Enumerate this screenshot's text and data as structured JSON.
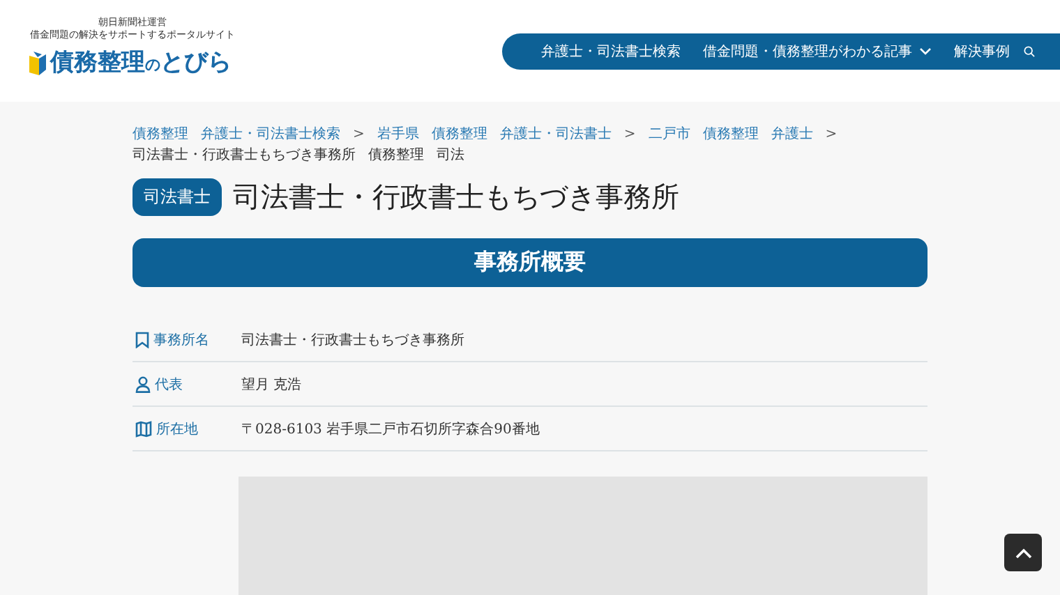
{
  "header": {
    "tagline_1": "朝日新聞社運営",
    "tagline_2": "借金問題の解決をサポートするポータルサイト",
    "logo": [
      {
        "text": "債務整理",
        "kind": "large"
      },
      {
        "text": "の",
        "kind": "small"
      },
      {
        "text": "とびら",
        "kind": "large"
      }
    ]
  },
  "nav": {
    "items": [
      {
        "label": "弁護士・司法書士検索",
        "kind": "link"
      },
      {
        "label": "借金問題・債務整理がわかる記事",
        "kind": "dropdown"
      },
      {
        "label": "解決事例",
        "kind": "link"
      }
    ]
  },
  "breadcrumb": [
    {
      "text": "債務整理",
      "kind": "link"
    },
    {
      "text": "弁護士・司法書士検索",
      "kind": "link"
    },
    {
      "text": ">",
      "kind": "separator"
    },
    {
      "text": "岩手県",
      "kind": "link"
    },
    {
      "text": "債務整理",
      "kind": "link"
    },
    {
      "text": "弁護士・司法書士",
      "kind": "link"
    },
    {
      "text": ">",
      "kind": "separator"
    },
    {
      "text": "二戸市",
      "kind": "link"
    },
    {
      "text": "債務整理",
      "kind": "link"
    },
    {
      "text": "弁護士",
      "kind": "link"
    },
    {
      "text": ">",
      "kind": "separator"
    },
    {
      "text": "司法書士・行政書士もちづき事務所",
      "kind": "current"
    },
    {
      "text": "債務整理",
      "kind": "current"
    },
    {
      "text": "司法",
      "kind": "current"
    }
  ],
  "office": {
    "badge": "司法書士",
    "name": "司法書士・行政書士もちづき事務所"
  },
  "section_title": "事務所概要",
  "details": [
    {
      "kind": "name",
      "label": "事務所名",
      "value": "司法書士・行政書士もちづき事務所"
    },
    {
      "kind": "person",
      "label": "代表",
      "value": "望月 克浩"
    },
    {
      "kind": "map",
      "label": "所在地",
      "value": "〒028-6103 岩手県二戸市石切所字森合90番地"
    }
  ]
}
